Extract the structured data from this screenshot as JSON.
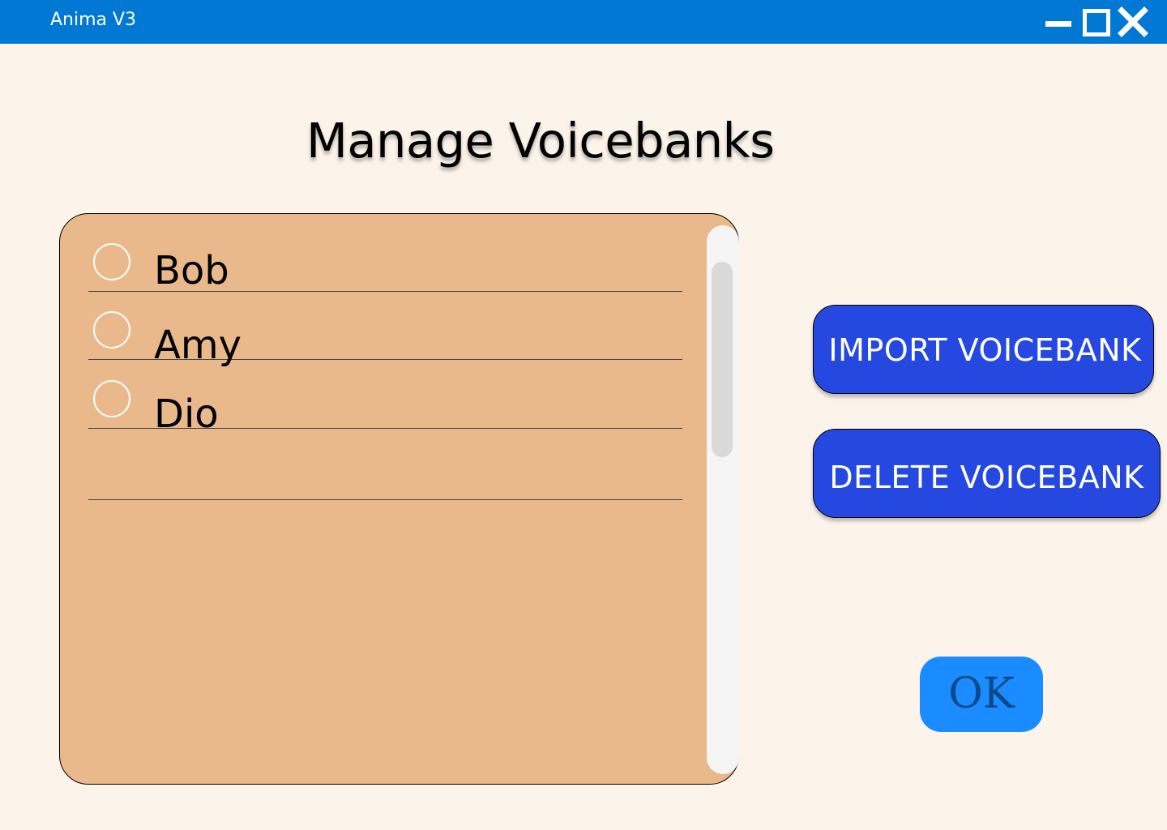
{
  "window": {
    "title": "Anima V3",
    "controls": {
      "minimize": "minimize-icon",
      "maximize": "maximize-icon",
      "close": "close-icon"
    },
    "titlebar_color": "#0078d4"
  },
  "page": {
    "title": "Manage Voicebanks",
    "background_color": "#fcf3ea"
  },
  "voicebank_list": {
    "panel_color": "#eab98b",
    "items": [
      {
        "label": "Bob",
        "selected": false
      },
      {
        "label": "Amy",
        "selected": false
      },
      {
        "label": "Dio",
        "selected": false
      },
      {
        "label": "",
        "selected": false
      }
    ]
  },
  "actions": {
    "import_label": "IMPORT VOICEBANK",
    "delete_label": "DELETE VOICEBANK",
    "ok_label": "OK",
    "action_color": "#2548e0",
    "ok_color": "#1a8cff"
  }
}
